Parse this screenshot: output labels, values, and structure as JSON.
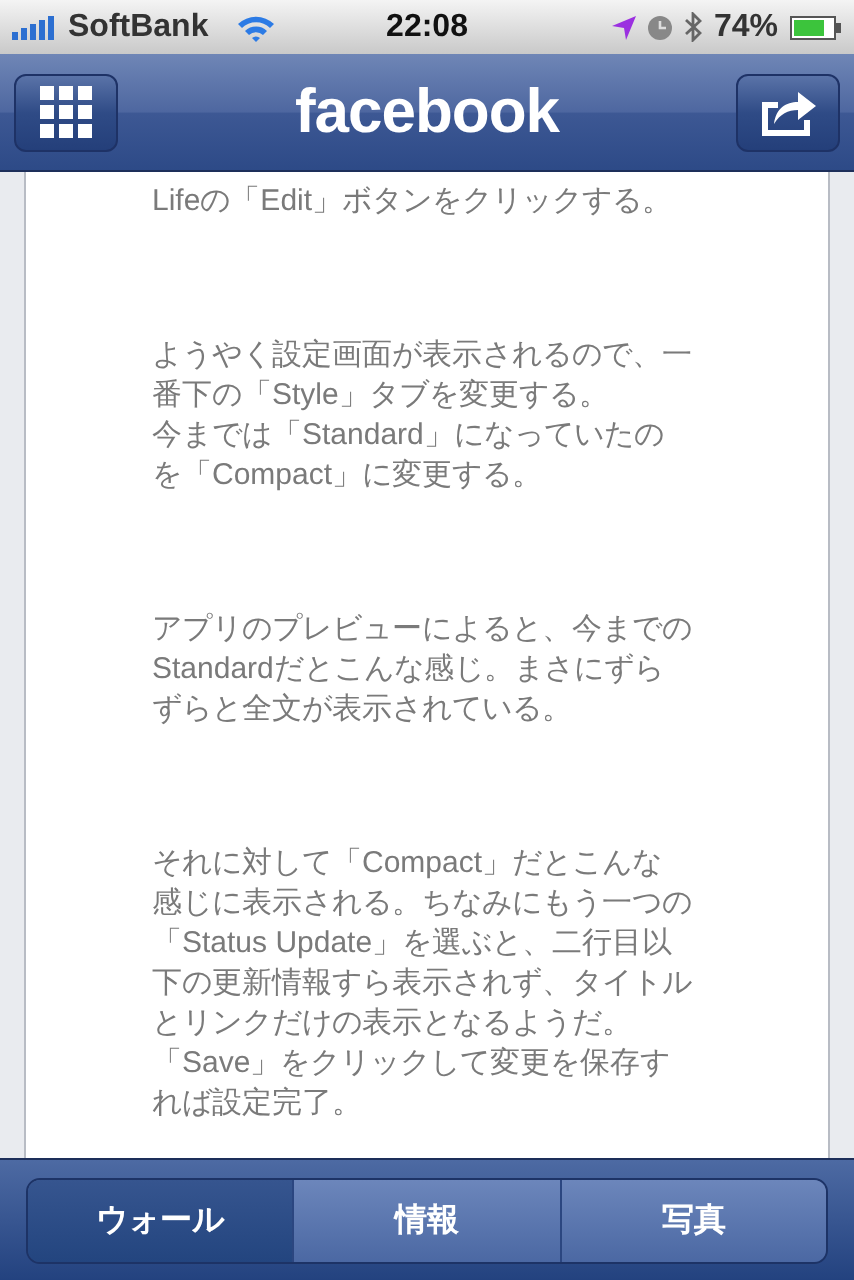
{
  "status_bar": {
    "carrier": "SoftBank",
    "time": "22:08",
    "battery": "74%"
  },
  "nav_bar": {
    "title": "facebook"
  },
  "article": {
    "paragraphs": [
      {
        "lines": [
          "Lifeの「Edit」ボタンをクリックする。"
        ]
      },
      {
        "lines": [
          "ようやく設定画面が表示されるので、一",
          "番下の「Style」タブを変更する。",
          "今までは「Standard」になっていたの",
          "を「Compact」に変更する。"
        ]
      },
      {
        "lines": [
          "アプリのプレビューによると、今までの",
          "Standardだとこんな感じ。まさにずら",
          "ずらと全文が表示されている。"
        ]
      },
      {
        "lines": [
          "それに対して「Compact」だとこんな",
          "感じに表示される。ちなみにもう一つの",
          "「Status Update」を選ぶと、二行目以",
          "下の更新情報すら表示されず、タイトル",
          "とリンクだけの表示となるようだ。",
          "「Save」をクリックして変更を保存す",
          "れば設定完了。"
        ]
      }
    ]
  },
  "tabs": [
    {
      "label": "ウォール",
      "selected": true
    },
    {
      "label": "情報",
      "selected": false
    },
    {
      "label": "写真",
      "selected": false
    }
  ]
}
